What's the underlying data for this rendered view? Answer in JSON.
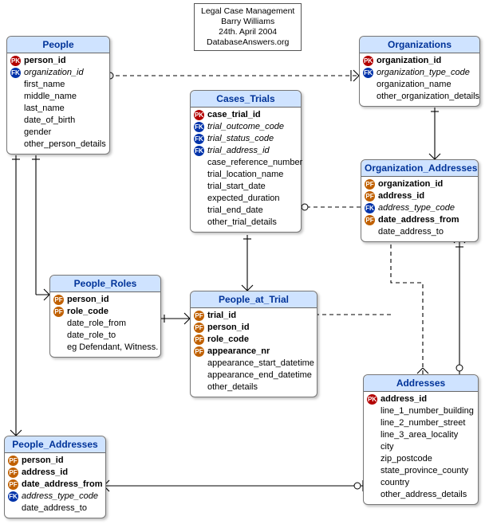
{
  "title_box": {
    "line1": "Legal Case Management",
    "line2": "Barry Williams",
    "line3": "24th. April 2004",
    "line4": "DatabaseAnswers.org"
  },
  "entities": {
    "people": {
      "header": "People",
      "cols": [
        {
          "key": "PK",
          "name": "person_id"
        },
        {
          "key": "FK",
          "name": "organization_id"
        },
        {
          "key": "",
          "name": "first_name"
        },
        {
          "key": "",
          "name": "middle_name"
        },
        {
          "key": "",
          "name": "last_name"
        },
        {
          "key": "",
          "name": "date_of_birth"
        },
        {
          "key": "",
          "name": "gender"
        },
        {
          "key": "",
          "name": "other_person_details"
        }
      ]
    },
    "organizations": {
      "header": "Organizations",
      "cols": [
        {
          "key": "PK",
          "name": "organization_id"
        },
        {
          "key": "FK",
          "name": "organization_type_code"
        },
        {
          "key": "",
          "name": "organization_name"
        },
        {
          "key": "",
          "name": "other_organization_details"
        }
      ]
    },
    "cases_trials": {
      "header": "Cases_Trials",
      "cols": [
        {
          "key": "PK",
          "name": "case_trial_id"
        },
        {
          "key": "FK",
          "name": "trial_outcome_code"
        },
        {
          "key": "FK",
          "name": "trial_status_code"
        },
        {
          "key": "FK",
          "name": "trial_address_id"
        },
        {
          "key": "",
          "name": "case_reference_number"
        },
        {
          "key": "",
          "name": "trial_location_name"
        },
        {
          "key": "",
          "name": "trial_start_date"
        },
        {
          "key": "",
          "name": "expected_duration"
        },
        {
          "key": "",
          "name": "trial_end_date"
        },
        {
          "key": "",
          "name": "other_trial_details"
        }
      ]
    },
    "org_addresses": {
      "header": "Organization_Addresses",
      "cols": [
        {
          "key": "PF",
          "name": "organization_id"
        },
        {
          "key": "PF",
          "name": "address_id"
        },
        {
          "key": "FK",
          "name": "address_type_code"
        },
        {
          "key": "PF",
          "name": "date_address_from"
        },
        {
          "key": "",
          "name": "date_address_to"
        }
      ]
    },
    "people_roles": {
      "header": "People_Roles",
      "cols": [
        {
          "key": "PF",
          "name": "person_id"
        },
        {
          "key": "PF",
          "name": "role_code"
        },
        {
          "key": "",
          "name": "date_role_from"
        },
        {
          "key": "",
          "name": "date_role_to"
        },
        {
          "key": "",
          "name": "eg Defendant, Witness."
        }
      ]
    },
    "people_at_trial": {
      "header": "People_at_Trial",
      "cols": [
        {
          "key": "PF",
          "name": "trial_id"
        },
        {
          "key": "PF",
          "name": "person_id"
        },
        {
          "key": "PF",
          "name": "role_code"
        },
        {
          "key": "PF",
          "name": "appearance_nr"
        },
        {
          "key": "",
          "name": "appearance_start_datetime"
        },
        {
          "key": "",
          "name": "appearance_end_datetime"
        },
        {
          "key": "",
          "name": "other_details"
        }
      ]
    },
    "addresses": {
      "header": "Addresses",
      "cols": [
        {
          "key": "PK",
          "name": "address_id"
        },
        {
          "key": "",
          "name": "line_1_number_building"
        },
        {
          "key": "",
          "name": "line_2_number_street"
        },
        {
          "key": "",
          "name": "line_3_area_locality"
        },
        {
          "key": "",
          "name": "city"
        },
        {
          "key": "",
          "name": "zip_postcode"
        },
        {
          "key": "",
          "name": "state_province_county"
        },
        {
          "key": "",
          "name": "country"
        },
        {
          "key": "",
          "name": "other_address_details"
        }
      ]
    },
    "people_addresses": {
      "header": "People_Addresses",
      "cols": [
        {
          "key": "PF",
          "name": "person_id"
        },
        {
          "key": "PF",
          "name": "address_id"
        },
        {
          "key": "PF",
          "name": "date_address_from"
        },
        {
          "key": "FK",
          "name": "address_type_code"
        },
        {
          "key": "",
          "name": "date_address_to"
        }
      ]
    }
  }
}
